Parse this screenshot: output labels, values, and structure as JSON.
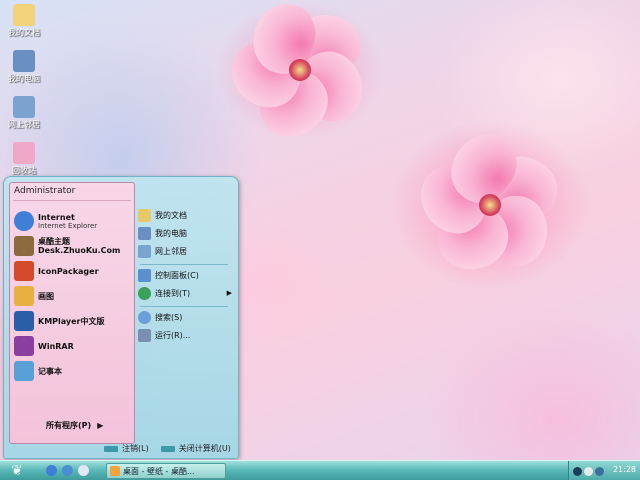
{
  "desktop": {
    "icons": [
      {
        "label": "我的文档",
        "icon": "folder-documents-icon",
        "color": "#f2d27a"
      },
      {
        "label": "我的电脑",
        "icon": "computer-icon",
        "color": "#6a8fc2"
      },
      {
        "label": "网上邻居",
        "icon": "network-icon",
        "color": "#7aa3d0"
      },
      {
        "label": "回收站",
        "icon": "recycle-bin-icon",
        "color": "#f0a8c8"
      }
    ]
  },
  "start_menu": {
    "user_name": "Administrator",
    "programs": [
      {
        "title": "Internet",
        "subtitle": "Internet Explorer",
        "icon": "internet-explorer-icon",
        "color": "#3f7fd8"
      },
      {
        "title": "桌酷主题",
        "subtitle": "Desk.ZhuoKu.Com",
        "icon": "zhuoku-icon",
        "color": "#8b6b3d"
      },
      {
        "title": "IconPackager",
        "subtitle": "",
        "icon": "iconpackager-icon",
        "color": "#d24a2a"
      },
      {
        "title": "画图",
        "subtitle": "",
        "icon": "paint-icon",
        "color": "#e8b040"
      },
      {
        "title": "KMPlayer中文版",
        "subtitle": "",
        "icon": "kmplayer-icon",
        "color": "#2b5ea8"
      },
      {
        "title": "WinRAR",
        "subtitle": "",
        "icon": "winrar-icon",
        "color": "#8a3fa0"
      },
      {
        "title": "记事本",
        "subtitle": "",
        "icon": "notepad-icon",
        "color": "#5aa0d8"
      }
    ],
    "all_programs": "所有程序(P)",
    "all_programs_arrow": "▶",
    "places": [
      {
        "label": "我的文档",
        "icon": "folder-documents-icon",
        "color": "#e8c96a"
      },
      {
        "label": "我的电脑",
        "icon": "computer-icon",
        "color": "#6a8fc2"
      },
      {
        "label": "网上邻居",
        "icon": "network-icon",
        "color": "#7aa3d0"
      }
    ],
    "tools": [
      {
        "label": "控制面板(C)",
        "icon": "control-panel-icon",
        "color": "#5a8fd0"
      },
      {
        "label": "连接到(T)",
        "icon": "connect-to-icon",
        "color": "#3aa05a",
        "arrow": "▶"
      }
    ],
    "misc": [
      {
        "label": "搜索(S)",
        "icon": "search-icon",
        "color": "#6a9fd8"
      },
      {
        "label": "运行(R)...",
        "icon": "run-icon",
        "color": "#7a8fb0"
      }
    ],
    "logoff": "注销(L)",
    "shutdown": "关闭计算机(U)"
  },
  "taskbar": {
    "start_glyph": "❦",
    "task_label": "桌面 - 壁纸 - 桌酷...",
    "clock": "21:28"
  }
}
